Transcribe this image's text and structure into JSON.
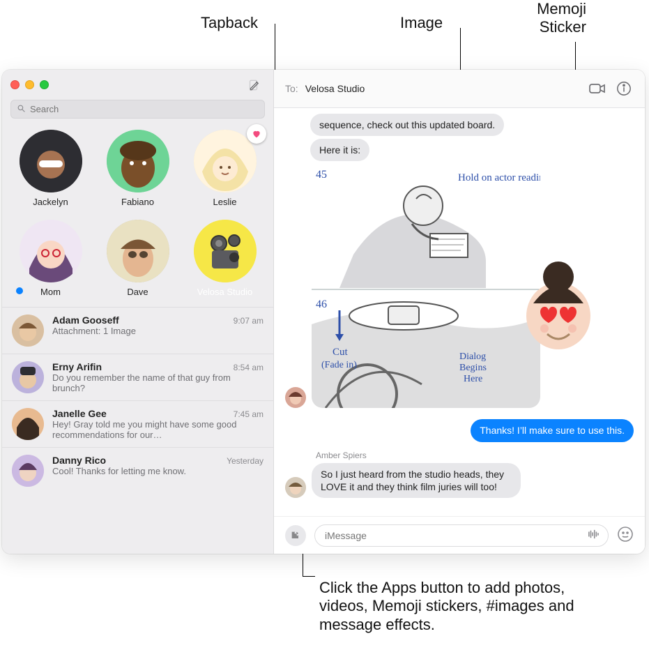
{
  "callouts": {
    "tapback": "Tapback",
    "image": "Image",
    "memoji": "Memoji\nSticker",
    "apps": "Click the Apps button to add photos, videos, Memoji stickers, #images and message effects."
  },
  "sidebar": {
    "search_placeholder": "Search",
    "pinned": [
      {
        "name": "Jackelyn",
        "selected": false
      },
      {
        "name": "Fabiano",
        "selected": false
      },
      {
        "name": "Leslie",
        "selected": false,
        "tapback": "heart"
      },
      {
        "name": "Mom",
        "selected": false,
        "unread": true
      },
      {
        "name": "Dave",
        "selected": false
      },
      {
        "name": "Velosa Studio",
        "selected": true
      }
    ],
    "conversations": [
      {
        "name": "Adam Gooseff",
        "time": "9:07 am",
        "preview": "Attachment: 1 Image"
      },
      {
        "name": "Erny Arifin",
        "time": "8:54 am",
        "preview": "Do you remember the name of that guy from brunch?"
      },
      {
        "name": "Janelle Gee",
        "time": "7:45 am",
        "preview": "Hey! Gray told me you might have some good recommendations for our…"
      },
      {
        "name": "Danny Rico",
        "time": "Yesterday",
        "preview": "Cool! Thanks for letting me know."
      }
    ]
  },
  "header": {
    "to_label": "To:",
    "to_value": "Velosa Studio"
  },
  "thread": {
    "msg1": "sequence, check out this updated board.",
    "msg2": "Here it is:",
    "board_annotations": {
      "frame1": "45",
      "note1": "Hold on actor reading",
      "frame2": "46",
      "cut": "Cut",
      "fade": "(Fade in)",
      "dialog": "Dialog\nBegins\nHere"
    },
    "reply1": "Thanks! I’ll make sure to use this.",
    "sender2": "Amber Spiers",
    "msg3": "So I just heard from the studio heads, they LOVE it and they think film juries will too!"
  },
  "input": {
    "placeholder": "iMessage"
  }
}
